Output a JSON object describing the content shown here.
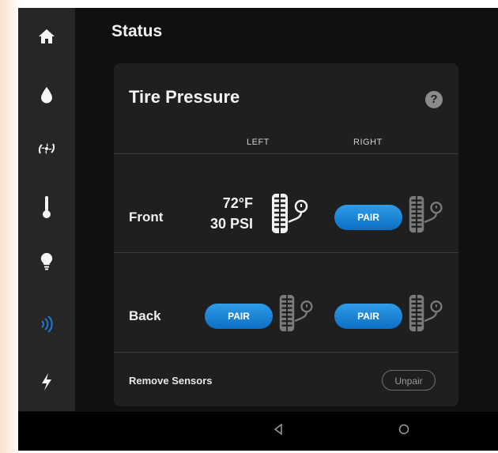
{
  "header": {
    "title": "Status"
  },
  "sidebar": {
    "items": [
      {
        "icon": "home-icon"
      },
      {
        "icon": "water-drop-icon"
      },
      {
        "icon": "fan-icon"
      },
      {
        "icon": "thermometer-icon"
      },
      {
        "icon": "lightbulb-icon"
      },
      {
        "icon": "signal-waves-icon",
        "active": true,
        "accent": "#1e7ad4"
      },
      {
        "icon": "lightning-icon"
      }
    ]
  },
  "card": {
    "title": "Tire Pressure",
    "help_label": "?",
    "columns": {
      "left": "LEFT",
      "right": "RIGHT"
    },
    "rows": {
      "front": {
        "label": "Front",
        "left_temp": "72°F",
        "left_pressure": "30 PSI",
        "right_button": "PAIR"
      },
      "back": {
        "label": "Back",
        "left_button": "PAIR",
        "right_button": "PAIR"
      }
    },
    "remove": {
      "label": "Remove Sensors",
      "button": "Unpair"
    }
  },
  "colors": {
    "accent": "#1e7ad4",
    "background": "#101010",
    "card": "#1f1f1f"
  }
}
